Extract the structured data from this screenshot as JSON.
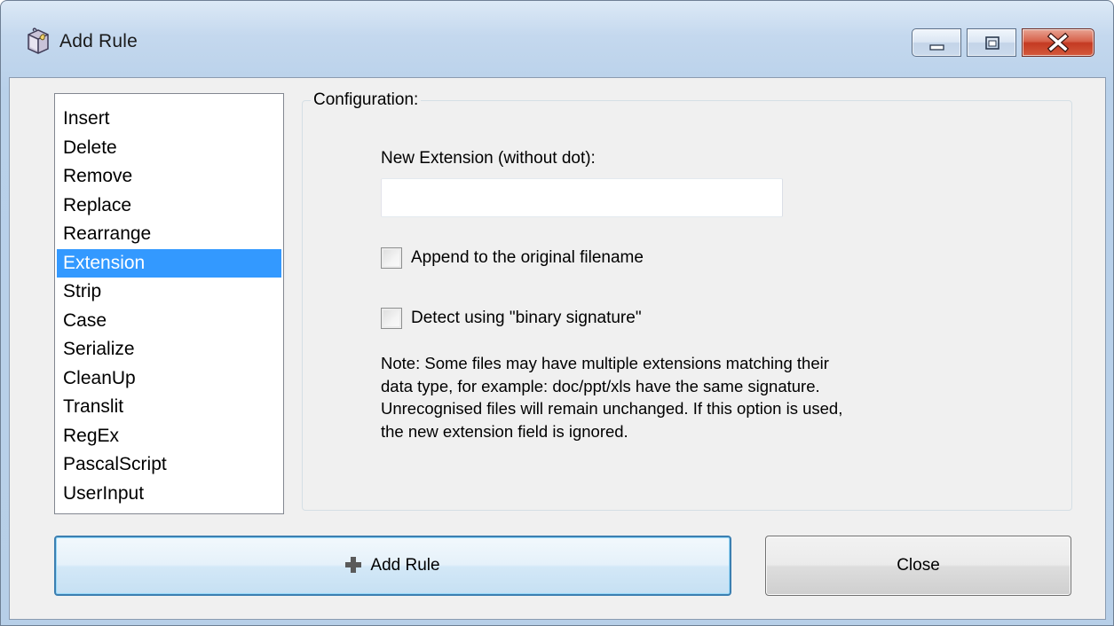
{
  "window": {
    "title": "Add Rule",
    "icon": "rule-box-icon",
    "controls": {
      "minimize_icon": "minimize-icon",
      "maximize_icon": "maximize-icon",
      "close_icon": "close-icon"
    }
  },
  "rules": {
    "items": [
      "Insert",
      "Delete",
      "Remove",
      "Replace",
      "Rearrange",
      "Extension",
      "Strip",
      "Case",
      "Serialize",
      "CleanUp",
      "Translit",
      "RegEx",
      "PascalScript",
      "UserInput"
    ],
    "selected": "Extension"
  },
  "config": {
    "legend": "Configuration:",
    "new_extension_label": "New Extension (without dot):",
    "new_extension_value": "",
    "append_label": "Append to the original filename",
    "append_checked": false,
    "detect_label": "Detect using \"binary signature\"",
    "detect_checked": false,
    "note_lines": [
      "Note: Some files may have multiple extensions matching their",
      "data type, for example: doc/ppt/xls have the same signature.",
      "Unrecognised files will remain unchanged. If this option is used,",
      "the new extension field is ignored."
    ]
  },
  "buttons": {
    "add_rule_label": "Add Rule",
    "add_rule_icon": "plus-icon",
    "close_label": "Close"
  },
  "colors": {
    "selection": "#3399ff",
    "add_button_border": "#3c7fb1",
    "plus_icon": "#5a5a5a"
  }
}
